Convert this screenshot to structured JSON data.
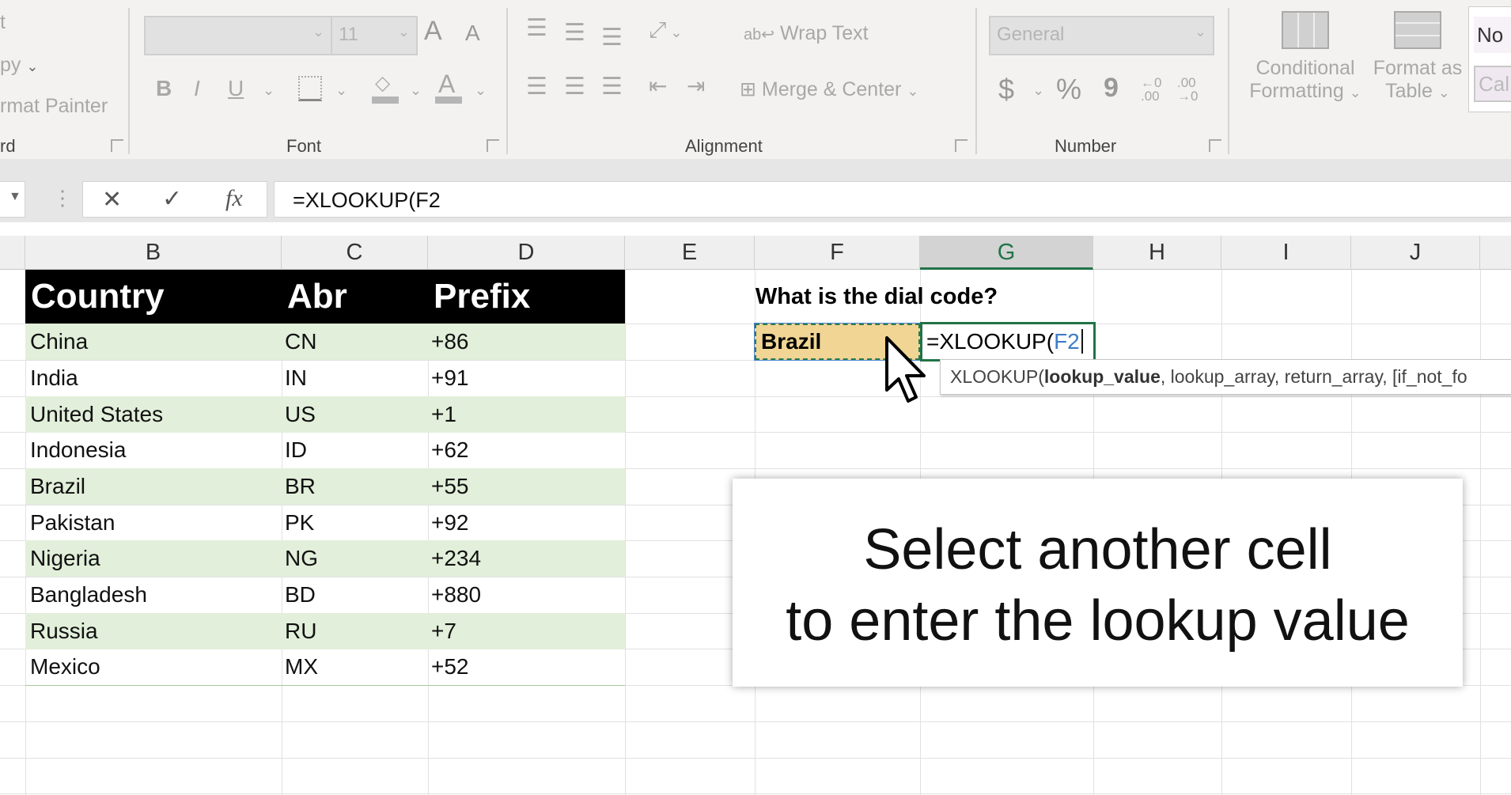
{
  "ribbon": {
    "clipboard": {
      "cut": "t",
      "copy": "py",
      "format_painter": "rmat Painter",
      "group": "rd"
    },
    "font": {
      "name": "",
      "size": "11",
      "bold": "B",
      "italic": "I",
      "underline": "U",
      "font_color": "A",
      "grow": "A",
      "shrink": "A",
      "group": "Font"
    },
    "alignment": {
      "wrap_text": "Wrap Text",
      "merge_center": "Merge & Center",
      "group": "Alignment"
    },
    "number": {
      "format": "General",
      "currency": "$",
      "percent": "%",
      "comma": "9",
      "inc_decimal": "←0 .00",
      "dec_decimal": ".00 →0",
      "group": "Number"
    },
    "styles": {
      "conditional_formatting": [
        "Conditional",
        "Formatting"
      ],
      "format_as_table": [
        "Format as",
        "Table"
      ],
      "style_normal": "No",
      "style_calc": "Cal"
    }
  },
  "formula_bar": {
    "cancel": "✕",
    "enter": "✓",
    "fx": "fx",
    "value": "=XLOOKUP(F2"
  },
  "columns": [
    "B",
    "C",
    "D",
    "E",
    "F",
    "G",
    "H",
    "I",
    "J"
  ],
  "table": {
    "headers": [
      "Country",
      "Abr",
      "Prefix"
    ],
    "rows": [
      [
        "China",
        "CN",
        "+86"
      ],
      [
        "India",
        "IN",
        "+91"
      ],
      [
        "United States",
        "US",
        "+1"
      ],
      [
        "Indonesia",
        "ID",
        "+62"
      ],
      [
        "Brazil",
        "BR",
        "+55"
      ],
      [
        "Pakistan",
        "PK",
        "+92"
      ],
      [
        "Nigeria",
        "NG",
        "+234"
      ],
      [
        "Bangladesh",
        "BD",
        "+880"
      ],
      [
        "Russia",
        "RU",
        "+7"
      ],
      [
        "Mexico",
        "MX",
        "+52"
      ]
    ]
  },
  "question": "What is the dial code?",
  "lookup_cell": "Brazil",
  "edit_cell": {
    "prefix": "=XLOOKUP(",
    "ref": "F2"
  },
  "tooltip": {
    "fn": "XLOOKUP(",
    "arg_bold": "lookup_value",
    "rest": ", lookup_array, return_array, [if_not_fo"
  },
  "caption": [
    "Select another cell",
    "to enter the lookup value"
  ],
  "colors": {
    "accent": "#217346",
    "band": "#e2efda",
    "lookup_fill": "#f0d594",
    "ref_blue": "#3d7cc9"
  }
}
